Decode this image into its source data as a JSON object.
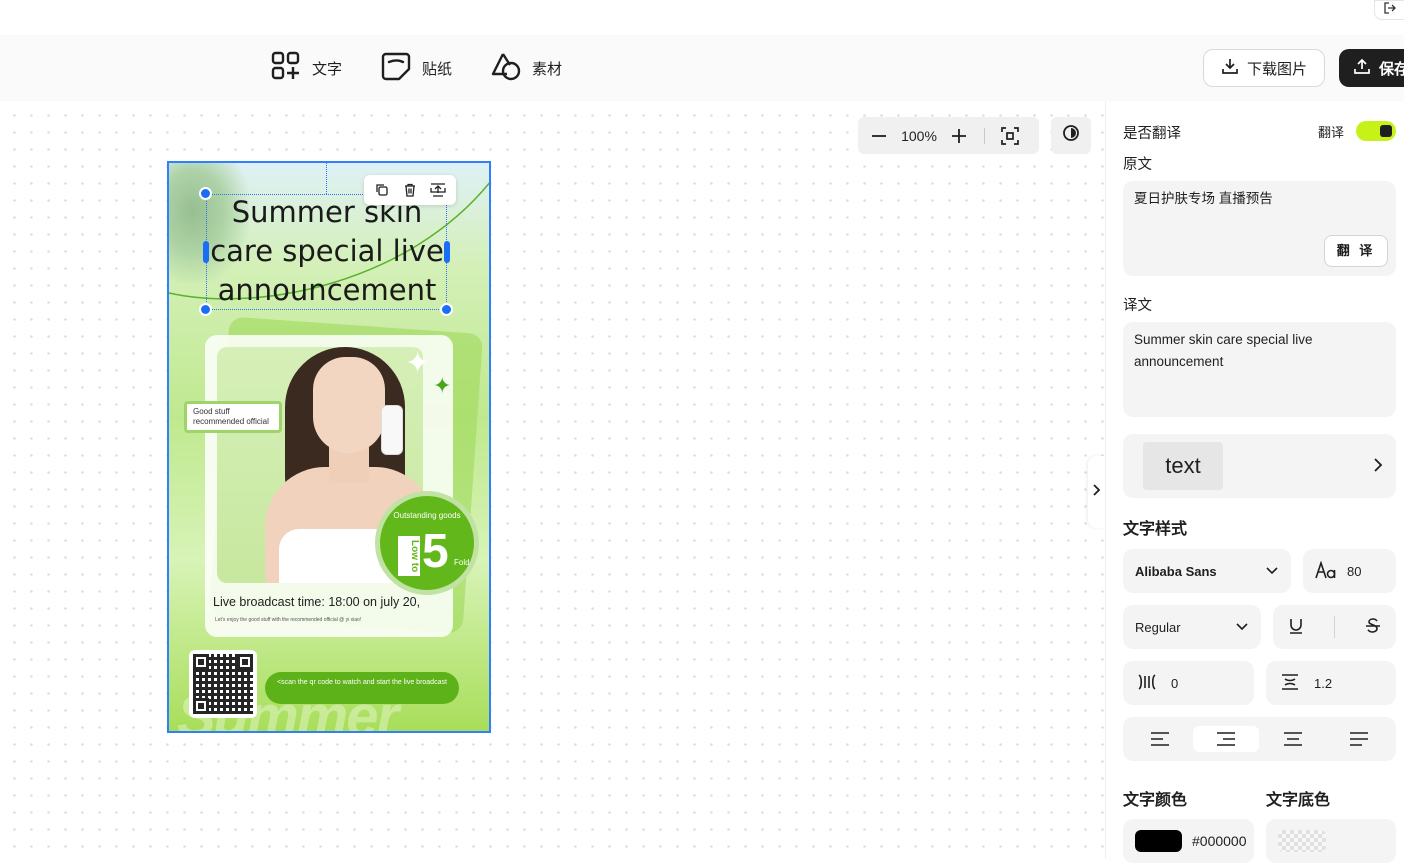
{
  "toolbar": {
    "tools": [
      {
        "label": "文字",
        "icon": "grid-plus-icon"
      },
      {
        "label": "贴纸",
        "icon": "sticker-icon"
      },
      {
        "label": "素材",
        "icon": "shapes-icon"
      }
    ],
    "download_label": "下载图片",
    "save_label": "保存"
  },
  "canvas": {
    "zoom": "100%"
  },
  "poster": {
    "title": "Summer skin care special live announcement",
    "good_tag": "Good stuff recommended official",
    "badge_top": "Outstanding goods",
    "badge_low": "Low to",
    "badge_number": "5",
    "badge_fold": "Fold",
    "live_time": "Live broadcast time: 18:00 on july 20,",
    "live_sub": "Let's enjoy the good stuff with the recommended official @ yi xiao!",
    "scan_text": "<scan the qr code to watch and start the live broadcast",
    "bg_word": "Summer"
  },
  "panel": {
    "translate_question": "是否翻译",
    "translate_toggle_label": "翻译",
    "translate_on": true,
    "source_label": "原文",
    "source_text": "夏日护肤专场 直播预告",
    "translate_button": "翻 译",
    "target_label": "译文",
    "target_text": "Summer skin care special live announcement",
    "preset_text": "text",
    "style_heading": "文字样式",
    "font_family": "Alibaba Sans",
    "font_size": "80",
    "font_weight": "Regular",
    "letter_spacing": "0",
    "line_height": "1.2",
    "text_color_heading": "文字颜色",
    "text_bg_heading": "文字底色",
    "text_color_value": "#000000",
    "accent_color": "#c6f21a"
  }
}
